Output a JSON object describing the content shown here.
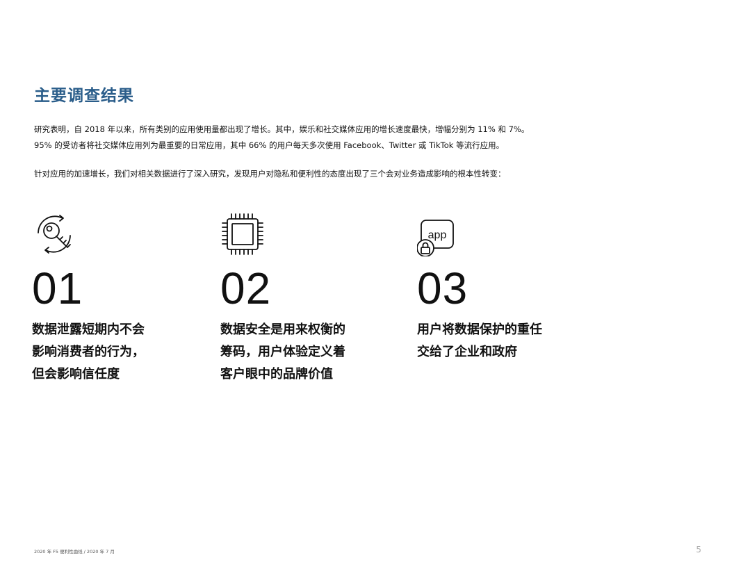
{
  "title": "主要调查结果",
  "paragraphs": {
    "p1_line1": "研究表明，自 2018 年以来，所有类别的应用使用量都出现了增长。其中，娱乐和社交媒体应用的增长速度最快，增幅分别为 11% 和 7%。",
    "p1_line2": "95% 的受访者将社交媒体应用列为最重要的日常应用，其中 66% 的用户每天多次使用 Facebook、Twitter 或 TikTok 等流行应用。",
    "p2": "针对应用的加速增长，我们对相关数据进行了深入研究，发现用户对隐私和便利性的态度出现了三个会对业务造成影响的根本性转变："
  },
  "findings": [
    {
      "icon": "key-rotate-icon",
      "number": "01",
      "lines": [
        "数据泄露短期内不会",
        "影响消费者的行为，",
        "但会影响信任度"
      ]
    },
    {
      "icon": "chip-icon",
      "number": "02",
      "lines": [
        "数据安全是用来权衡的",
        "筹码，用户体验定义着",
        "客户眼中的品牌价值"
      ]
    },
    {
      "icon": "app-lock-icon",
      "app_label": "app",
      "number": "03",
      "lines": [
        "用户将数据保护的重任",
        "交给了企业和政府"
      ]
    }
  ],
  "footer": "2020 年 F5 便利性曲线 / 2020 年 7 月",
  "page_number": "5",
  "colors": {
    "title": "#2a5d8a",
    "text": "#111111",
    "page_number": "#b0b0b0"
  }
}
